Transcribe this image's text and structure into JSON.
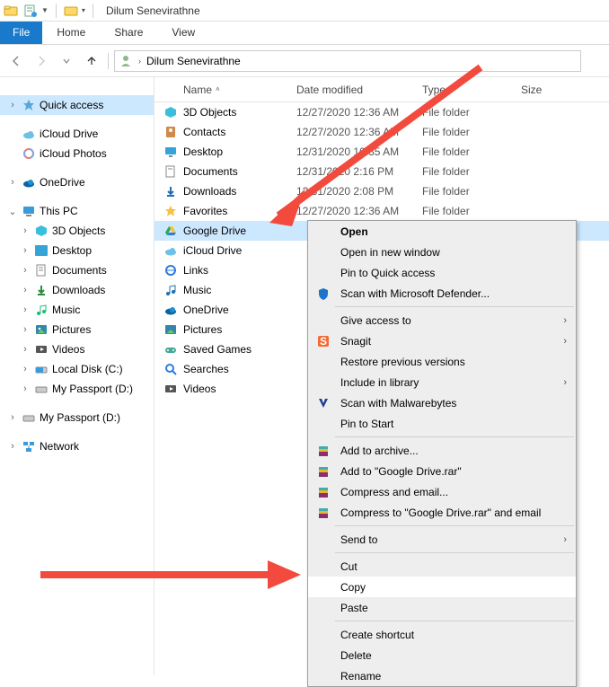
{
  "title": "Dilum Senevirathne",
  "ribbon": {
    "file": "File",
    "home": "Home",
    "share": "Share",
    "view": "View"
  },
  "breadcrumb": {
    "current": "Dilum Senevirathne"
  },
  "columns": {
    "name": "Name",
    "date": "Date modified",
    "type": "Type",
    "size": "Size"
  },
  "sidebar": {
    "quick_access": "Quick access",
    "icloud_drive": "iCloud Drive",
    "icloud_photos": "iCloud Photos",
    "onedrive": "OneDrive",
    "this_pc": "This PC",
    "threed": "3D Objects",
    "desktop": "Desktop",
    "documents": "Documents",
    "downloads": "Downloads",
    "music": "Music",
    "pictures": "Pictures",
    "videos": "Videos",
    "local_disk": "Local Disk (C:)",
    "passport1": "My Passport (D:)",
    "passport2": "My Passport (D:)",
    "network": "Network"
  },
  "files": [
    {
      "name": "3D Objects",
      "date": "12/27/2020 12:36 AM",
      "type": "File folder"
    },
    {
      "name": "Contacts",
      "date": "12/27/2020 12:36 AM",
      "type": "File folder"
    },
    {
      "name": "Desktop",
      "date": "12/31/2020 10:35 AM",
      "type": "File folder"
    },
    {
      "name": "Documents",
      "date": "12/31/2020 2:16 PM",
      "type": "File folder"
    },
    {
      "name": "Downloads",
      "date": "12/31/2020 2:08 PM",
      "type": "File folder"
    },
    {
      "name": "Favorites",
      "date": "12/27/2020 12:36 AM",
      "type": "File folder"
    },
    {
      "name": "Google Drive",
      "date": "",
      "type": ""
    },
    {
      "name": "iCloud Drive",
      "date": "",
      "type": ""
    },
    {
      "name": "Links",
      "date": "",
      "type": ""
    },
    {
      "name": "Music",
      "date": "",
      "type": ""
    },
    {
      "name": "OneDrive",
      "date": "",
      "type": ""
    },
    {
      "name": "Pictures",
      "date": "",
      "type": ""
    },
    {
      "name": "Saved Games",
      "date": "",
      "type": ""
    },
    {
      "name": "Searches",
      "date": "",
      "type": ""
    },
    {
      "name": "Videos",
      "date": "",
      "type": ""
    }
  ],
  "context_menu": {
    "open": "Open",
    "open_new": "Open in new window",
    "pin_quick": "Pin to Quick access",
    "defender": "Scan with Microsoft Defender...",
    "give_access": "Give access to",
    "snagit": "Snagit",
    "restore": "Restore previous versions",
    "include_lib": "Include in library",
    "malwarebytes": "Scan with Malwarebytes",
    "pin_start": "Pin to Start",
    "add_archive": "Add to archive...",
    "add_rar": "Add to \"Google Drive.rar\"",
    "compress_email": "Compress and email...",
    "compress_rar_email": "Compress to \"Google Drive.rar\" and email",
    "send_to": "Send to",
    "cut": "Cut",
    "copy": "Copy",
    "paste": "Paste",
    "create_shortcut": "Create shortcut",
    "delete": "Delete",
    "rename": "Rename"
  }
}
